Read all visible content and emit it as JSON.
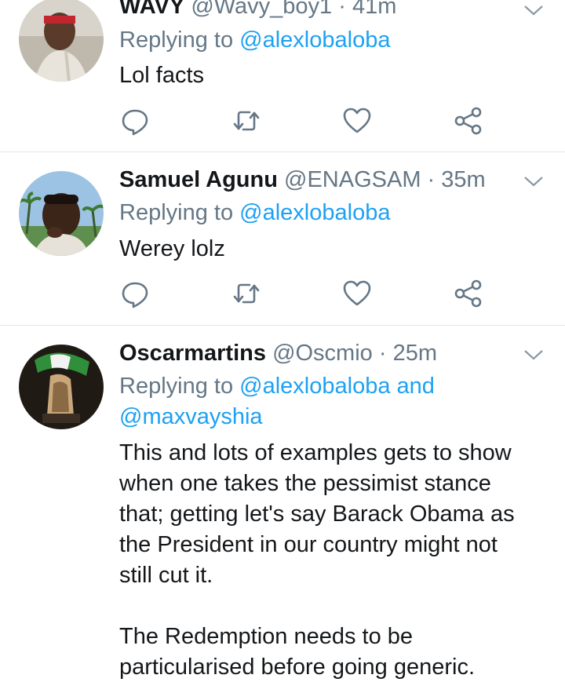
{
  "tweets": [
    {
      "name": "WAVY",
      "handle": "@Wavy_boy1",
      "sep": "·",
      "time": "41m",
      "replying_prefix": "Replying to",
      "mention": "@alexlobaloba",
      "text": "Lol facts"
    },
    {
      "name": "Samuel Agunu",
      "handle": "@ENAGSAM",
      "sep": "·",
      "time": "35m",
      "replying_prefix": "Replying to",
      "mention": "@alexlobaloba",
      "text": "Werey lolz"
    },
    {
      "name": "Oscarmartins",
      "handle": "@Oscmio",
      "sep": "·",
      "time": "25m",
      "replying_prefix": "Replying to",
      "mention": "@alexlobaloba",
      "mention_and": "and",
      "mention2": "@maxvayshia",
      "text_lines": [
        "This and lots of examples gets to show",
        "when one takes the pessimist stance",
        "that; getting let's say Barack Obama as",
        "the President in our country might not",
        "still cut it.",
        "",
        "The Redemption needs to be",
        "particularised before going generic."
      ]
    }
  ],
  "colors": {
    "link": "#1da1f2",
    "muted": "#657786",
    "text": "#14171a",
    "divider": "#e1e8ed"
  },
  "icons": [
    "reply-icon",
    "retweet-icon",
    "like-icon",
    "share-icon",
    "chevron-down-icon"
  ]
}
